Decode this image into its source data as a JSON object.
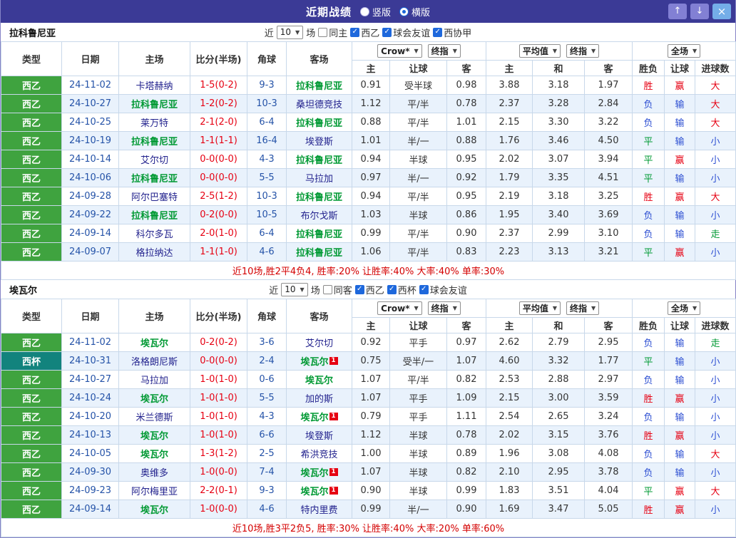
{
  "titlebar": {
    "title": "近期战绩",
    "vertical_label": "竖版",
    "horizontal_label": "横版",
    "selected_layout": "横版",
    "up_icon": "↑",
    "down_icon": "↓",
    "close_icon": "×"
  },
  "colors": {
    "titlebar_bg": "#3b3a96",
    "league_green": "#3fa33f",
    "league_teal": "#12837d",
    "focus_team_green": "#009933",
    "win_red": "#e60012",
    "lose_blue": "#2d4fd2",
    "draw_green": "#009933",
    "row_alt_bg": "#e9f2fc"
  },
  "table_headers": {
    "type": "类型",
    "date": "日期",
    "home": "主场",
    "score": "比分(半场)",
    "corner": "角球",
    "away": "客场",
    "ah_home": "主",
    "ah_line": "让球",
    "ah_away": "客",
    "eu_home": "主",
    "eu_draw": "和",
    "eu_away": "客",
    "result": "胜负",
    "ah_result": "让球",
    "goal": "进球数"
  },
  "dropdowns": {
    "bookmaker": "Crow*",
    "final1": "终指",
    "average": "平均值",
    "final2": "终指",
    "scope": "全场"
  },
  "value_colors": {
    "西乙": "lg-green",
    "西杯": "lg-teal",
    "胜": "c-red",
    "平": "c-green",
    "负": "c-blue",
    "赢": "c-red",
    "输": "c-blue",
    "大": "c-red",
    "小": "c-blue",
    "走": "c-green"
  },
  "row_columns": [
    {
      "key": "type",
      "name": "league-type-cell",
      "cls": "type",
      "inter": false
    },
    {
      "key": "date",
      "name": "date-cell",
      "cls": "date",
      "inter": false
    },
    {
      "key": "home",
      "name": "home-team-cell",
      "cls": "team",
      "inter": true
    },
    {
      "key": "score",
      "name": "score-cell",
      "cls": "score",
      "inter": false
    },
    {
      "key": "corner",
      "name": "corner-cell",
      "cls": "corner",
      "inter": false
    },
    {
      "key": "away",
      "name": "away-team-cell",
      "cls": "team",
      "inter": true
    },
    {
      "key": "ah_home",
      "name": "handicap-home-odds-cell",
      "cls": "num",
      "inter": false
    },
    {
      "key": "ah_line",
      "name": "handicap-line-cell",
      "cls": "num",
      "inter": false
    },
    {
      "key": "ah_away",
      "name": "handicap-away-odds-cell",
      "cls": "num",
      "inter": false
    },
    {
      "key": "eu_home",
      "name": "avg-home-odds-cell",
      "cls": "num",
      "inter": false
    },
    {
      "key": "eu_draw",
      "name": "avg-draw-odds-cell",
      "cls": "num",
      "inter": false
    },
    {
      "key": "eu_away",
      "name": "avg-away-odds-cell",
      "cls": "num",
      "inter": false
    },
    {
      "key": "result",
      "name": "result-cell",
      "cls": "res",
      "inter": false
    },
    {
      "key": "ah_result",
      "name": "handicap-result-cell",
      "cls": "res",
      "inter": false
    },
    {
      "key": "goal",
      "name": "goal-result-cell",
      "cls": "res",
      "inter": false
    }
  ],
  "sections": [
    {
      "team": "拉科鲁尼亚",
      "filter": {
        "near": "近",
        "count": "10",
        "games": "场",
        "same": {
          "label": "同主",
          "checked": false
        },
        "leagues": [
          {
            "label": "西乙",
            "checked": true
          },
          {
            "label": "球会友谊",
            "checked": true
          },
          {
            "label": "西协甲",
            "checked": true
          }
        ]
      },
      "rows": [
        {
          "type": "西乙",
          "date": "24-11-02",
          "home": "卡塔赫纳",
          "score": "1-5(0-2)",
          "corner": "9-3",
          "away": "拉科鲁尼亚",
          "ah_home": "0.91",
          "ah_line": "受半球",
          "ah_away": "0.98",
          "eu_home": "3.88",
          "eu_draw": "3.18",
          "eu_away": "1.97",
          "result": "胜",
          "ah_result": "赢",
          "goal": "大"
        },
        {
          "type": "西乙",
          "date": "24-10-27",
          "home": "拉科鲁尼亚",
          "score": "1-2(0-2)",
          "corner": "10-3",
          "away": "桑坦德竞技",
          "ah_home": "1.12",
          "ah_line": "平/半",
          "ah_away": "0.78",
          "eu_home": "2.37",
          "eu_draw": "3.28",
          "eu_away": "2.84",
          "result": "负",
          "ah_result": "输",
          "goal": "大"
        },
        {
          "type": "西乙",
          "date": "24-10-25",
          "home": "莱万特",
          "score": "2-1(2-0)",
          "corner": "6-4",
          "away": "拉科鲁尼亚",
          "ah_home": "0.88",
          "ah_line": "平/半",
          "ah_away": "1.01",
          "eu_home": "2.15",
          "eu_draw": "3.30",
          "eu_away": "3.22",
          "result": "负",
          "ah_result": "输",
          "goal": "大"
        },
        {
          "type": "西乙",
          "date": "24-10-19",
          "home": "拉科鲁尼亚",
          "score": "1-1(1-1)",
          "corner": "16-4",
          "away": "埃登斯",
          "ah_home": "1.01",
          "ah_line": "半/一",
          "ah_away": "0.88",
          "eu_home": "1.76",
          "eu_draw": "3.46",
          "eu_away": "4.50",
          "result": "平",
          "ah_result": "输",
          "goal": "小"
        },
        {
          "type": "西乙",
          "date": "24-10-14",
          "home": "艾尔切",
          "score": "0-0(0-0)",
          "corner": "4-3",
          "away": "拉科鲁尼亚",
          "ah_home": "0.94",
          "ah_line": "半球",
          "ah_away": "0.95",
          "eu_home": "2.02",
          "eu_draw": "3.07",
          "eu_away": "3.94",
          "result": "平",
          "ah_result": "赢",
          "goal": "小"
        },
        {
          "type": "西乙",
          "date": "24-10-06",
          "home": "拉科鲁尼亚",
          "score": "0-0(0-0)",
          "corner": "5-5",
          "away": "马拉加",
          "ah_home": "0.97",
          "ah_line": "半/一",
          "ah_away": "0.92",
          "eu_home": "1.79",
          "eu_draw": "3.35",
          "eu_away": "4.51",
          "result": "平",
          "ah_result": "输",
          "goal": "小"
        },
        {
          "type": "西乙",
          "date": "24-09-28",
          "home": "阿尔巴塞特",
          "score": "2-5(1-2)",
          "corner": "10-3",
          "away": "拉科鲁尼亚",
          "ah_home": "0.94",
          "ah_line": "平/半",
          "ah_away": "0.95",
          "eu_home": "2.19",
          "eu_draw": "3.18",
          "eu_away": "3.25",
          "result": "胜",
          "ah_result": "赢",
          "goal": "大"
        },
        {
          "type": "西乙",
          "date": "24-09-22",
          "home": "拉科鲁尼亚",
          "score": "0-2(0-0)",
          "corner": "10-5",
          "away": "布尔戈斯",
          "ah_home": "1.03",
          "ah_line": "半球",
          "ah_away": "0.86",
          "eu_home": "1.95",
          "eu_draw": "3.40",
          "eu_away": "3.69",
          "result": "负",
          "ah_result": "输",
          "goal": "小"
        },
        {
          "type": "西乙",
          "date": "24-09-14",
          "home": "科尔多瓦",
          "score": "2-0(1-0)",
          "corner": "6-4",
          "away": "拉科鲁尼亚",
          "ah_home": "0.99",
          "ah_line": "平/半",
          "ah_away": "0.90",
          "eu_home": "2.37",
          "eu_draw": "2.99",
          "eu_away": "3.10",
          "result": "负",
          "ah_result": "输",
          "goal": "走"
        },
        {
          "type": "西乙",
          "date": "24-09-07",
          "home": "格拉纳达",
          "score": "1-1(1-0)",
          "corner": "4-6",
          "away": "拉科鲁尼亚",
          "ah_home": "1.06",
          "ah_line": "平/半",
          "ah_away": "0.83",
          "eu_home": "2.23",
          "eu_draw": "3.13",
          "eu_away": "3.21",
          "result": "平",
          "ah_result": "赢",
          "goal": "小"
        }
      ],
      "summary": "近10场,胜2平4负4, 胜率:20% 让胜率:40% 大率:40% 单率:30%"
    },
    {
      "team": "埃瓦尔",
      "filter": {
        "near": "近",
        "count": "10",
        "games": "场",
        "same": {
          "label": "同客",
          "checked": false
        },
        "leagues": [
          {
            "label": "西乙",
            "checked": true
          },
          {
            "label": "西杯",
            "checked": true
          },
          {
            "label": "球会友谊",
            "checked": true
          }
        ]
      },
      "rows": [
        {
          "type": "西乙",
          "date": "24-11-02",
          "home": "埃瓦尔",
          "score": "0-2(0-2)",
          "corner": "3-6",
          "away": "艾尔切",
          "ah_home": "0.92",
          "ah_line": "平手",
          "ah_away": "0.97",
          "eu_home": "2.62",
          "eu_draw": "2.79",
          "eu_away": "2.95",
          "result": "负",
          "ah_result": "输",
          "goal": "走"
        },
        {
          "type": "西杯",
          "date": "24-10-31",
          "home": "洛格朗尼斯",
          "score": "0-0(0-0)",
          "corner": "2-4",
          "away": {
            "t": "埃瓦尔",
            "badge": "1"
          },
          "ah_home": "0.75",
          "ah_line": "受半/一",
          "ah_away": "1.07",
          "eu_home": "4.60",
          "eu_draw": "3.32",
          "eu_away": "1.77",
          "result": "平",
          "ah_result": "输",
          "goal": "小"
        },
        {
          "type": "西乙",
          "date": "24-10-27",
          "home": "马拉加",
          "score": "1-0(1-0)",
          "corner": "0-6",
          "away": "埃瓦尔",
          "ah_home": "1.07",
          "ah_line": "平/半",
          "ah_away": "0.82",
          "eu_home": "2.53",
          "eu_draw": "2.88",
          "eu_away": "2.97",
          "result": "负",
          "ah_result": "输",
          "goal": "小"
        },
        {
          "type": "西乙",
          "date": "24-10-24",
          "home": "埃瓦尔",
          "score": "1-0(1-0)",
          "corner": "5-5",
          "away": "加的斯",
          "ah_home": "1.07",
          "ah_line": "平手",
          "ah_away": "1.09",
          "eu_home": "2.15",
          "eu_draw": "3.00",
          "eu_away": "3.59",
          "result": "胜",
          "ah_result": "赢",
          "goal": "小"
        },
        {
          "type": "西乙",
          "date": "24-10-20",
          "home": "米兰德斯",
          "score": "1-0(1-0)",
          "corner": "4-3",
          "away": {
            "t": "埃瓦尔",
            "badge": "1"
          },
          "ah_home": "0.79",
          "ah_line": "平手",
          "ah_away": "1.11",
          "eu_home": "2.54",
          "eu_draw": "2.65",
          "eu_away": "3.24",
          "result": "负",
          "ah_result": "输",
          "goal": "小"
        },
        {
          "type": "西乙",
          "date": "24-10-13",
          "home": "埃瓦尔",
          "score": "1-0(1-0)",
          "corner": "6-6",
          "away": "埃登斯",
          "ah_home": "1.12",
          "ah_line": "半球",
          "ah_away": "0.78",
          "eu_home": "2.02",
          "eu_draw": "3.15",
          "eu_away": "3.76",
          "result": "胜",
          "ah_result": "赢",
          "goal": "小"
        },
        {
          "type": "西乙",
          "date": "24-10-05",
          "home": "埃瓦尔",
          "score": "1-3(1-2)",
          "corner": "2-5",
          "away": "希洪竞技",
          "ah_home": "1.00",
          "ah_line": "半球",
          "ah_away": "0.89",
          "eu_home": "1.96",
          "eu_draw": "3.08",
          "eu_away": "4.08",
          "result": "负",
          "ah_result": "输",
          "goal": "大"
        },
        {
          "type": "西乙",
          "date": "24-09-30",
          "home": "奥维多",
          "score": "1-0(0-0)",
          "corner": "7-4",
          "away": {
            "t": "埃瓦尔",
            "badge": "1"
          },
          "ah_home": "1.07",
          "ah_line": "半球",
          "ah_away": "0.82",
          "eu_home": "2.10",
          "eu_draw": "2.95",
          "eu_away": "3.78",
          "result": "负",
          "ah_result": "输",
          "goal": "小"
        },
        {
          "type": "西乙",
          "date": "24-09-23",
          "home": "阿尔梅里亚",
          "score": "2-2(0-1)",
          "corner": "9-3",
          "away": {
            "t": "埃瓦尔",
            "badge": "1"
          },
          "ah_home": "0.90",
          "ah_line": "半球",
          "ah_away": "0.99",
          "eu_home": "1.83",
          "eu_draw": "3.51",
          "eu_away": "4.04",
          "result": "平",
          "ah_result": "赢",
          "goal": "大"
        },
        {
          "type": "西乙",
          "date": "24-09-14",
          "home": "埃瓦尔",
          "score": "1-0(0-0)",
          "corner": "4-6",
          "away": "特内里费",
          "ah_home": "0.99",
          "ah_line": "半/一",
          "ah_away": "0.90",
          "eu_home": "1.69",
          "eu_draw": "3.47",
          "eu_away": "5.05",
          "result": "胜",
          "ah_result": "赢",
          "goal": "小"
        }
      ],
      "summary": "近10场,胜3平2负5, 胜率:30% 让胜率:40% 大率:20% 单率:60%"
    }
  ]
}
